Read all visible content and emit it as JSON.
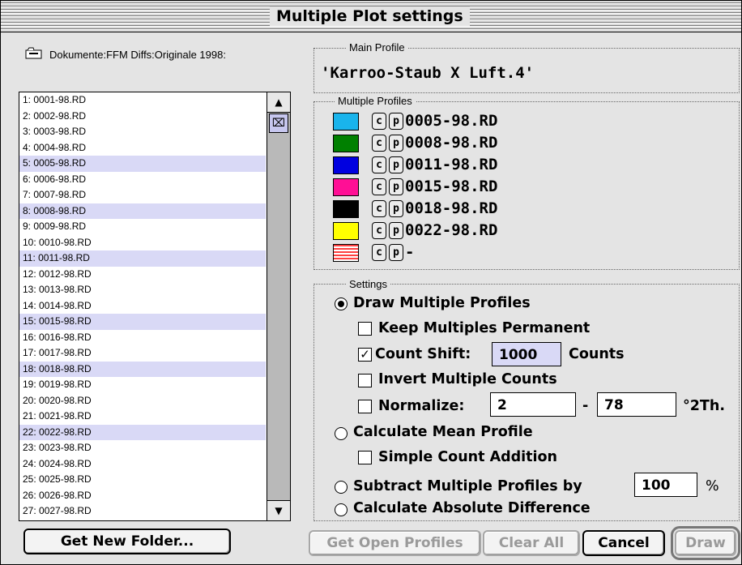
{
  "window": {
    "title": "Multiple Plot settings"
  },
  "folder": {
    "path": "Dokumente:FFM Diffs:Originale 1998:",
    "icon": "folder-icon"
  },
  "file_list": {
    "items": [
      {
        "label": "1: 0001-98.RD",
        "selected": false
      },
      {
        "label": "2: 0002-98.RD",
        "selected": false
      },
      {
        "label": "3: 0003-98.RD",
        "selected": false
      },
      {
        "label": "4: 0004-98.RD",
        "selected": false
      },
      {
        "label": "5: 0005-98.RD",
        "selected": true
      },
      {
        "label": "6: 0006-98.RD",
        "selected": false
      },
      {
        "label": "7: 0007-98.RD",
        "selected": false
      },
      {
        "label": "8: 0008-98.RD",
        "selected": true
      },
      {
        "label": "9: 0009-98.RD",
        "selected": false
      },
      {
        "label": "10: 0010-98.RD",
        "selected": false
      },
      {
        "label": "11: 0011-98.RD",
        "selected": true
      },
      {
        "label": "12: 0012-98.RD",
        "selected": false
      },
      {
        "label": "13: 0013-98.RD",
        "selected": false
      },
      {
        "label": "14: 0014-98.RD",
        "selected": false
      },
      {
        "label": "15: 0015-98.RD",
        "selected": true
      },
      {
        "label": "16: 0016-98.RD",
        "selected": false
      },
      {
        "label": "17: 0017-98.RD",
        "selected": false
      },
      {
        "label": "18: 0018-98.RD",
        "selected": true
      },
      {
        "label": "19: 0019-98.RD",
        "selected": false
      },
      {
        "label": "20: 0020-98.RD",
        "selected": false
      },
      {
        "label": "21: 0021-98.RD",
        "selected": false
      },
      {
        "label": "22: 0022-98.RD",
        "selected": true
      },
      {
        "label": "23: 0023-98.RD",
        "selected": false
      },
      {
        "label": "24: 0024-98.RD",
        "selected": false
      },
      {
        "label": "25: 0025-98.RD",
        "selected": false
      },
      {
        "label": "26: 0026-98.RD",
        "selected": false
      },
      {
        "label": "27: 0027-98.RD",
        "selected": false
      }
    ]
  },
  "buttons": {
    "get_new_folder": "Get New Folder...",
    "get_open_profiles": "Get Open Profiles",
    "clear_all": "Clear All",
    "cancel": "Cancel",
    "draw": "Draw"
  },
  "main_profile": {
    "group_label": "Main Profile",
    "value": "'Karroo-Staub X Luft.4'"
  },
  "multiple_profiles": {
    "group_label": "Multiple Profiles",
    "c_label": "c",
    "p_label": "p",
    "rows": [
      {
        "color": "#19b4ec",
        "name": "0005-98.RD"
      },
      {
        "color": "#008000",
        "name": "0008-98.RD"
      },
      {
        "color": "#0000e0",
        "name": "0011-98.RD"
      },
      {
        "color": "#ff0f95",
        "name": "0015-98.RD"
      },
      {
        "color": "#000000",
        "name": "0018-98.RD"
      },
      {
        "color": "#ffff00",
        "name": "0022-98.RD"
      },
      {
        "color": "striped-red",
        "name": "-"
      }
    ]
  },
  "settings": {
    "group_label": "Settings",
    "draw_multiple": "Draw Multiple Profiles",
    "keep_permanent": "Keep Multiples Permanent",
    "count_shift": "Count Shift:",
    "count_shift_value": "1000",
    "counts_unit": "Counts",
    "invert_counts": "Invert Multiple Counts",
    "normalize": "Normalize:",
    "normalize_from": "2",
    "normalize_dash": "-",
    "normalize_to": "78",
    "normalize_unit": "°2Th.",
    "calculate_mean": "Calculate Mean Profile",
    "simple_addition": "Simple Count Addition",
    "subtract_by": "Subtract Multiple Profiles by",
    "subtract_value": "100",
    "percent": "%",
    "absolute_difference": "Calculate Absolute Difference",
    "selected_option": "draw_multiple",
    "count_shift_checked": true
  }
}
